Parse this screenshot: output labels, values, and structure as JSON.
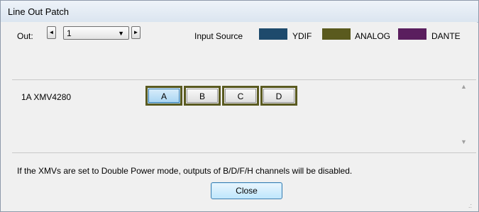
{
  "window": {
    "title": "Line Out Patch"
  },
  "out": {
    "label": "Out:",
    "prev_icon": "left-arrow-icon",
    "prev_glyph": "◄",
    "next_icon": "right-arrow-icon",
    "next_glyph": "►",
    "selected_value": "1",
    "dropdown_glyph": "▼"
  },
  "input_source": {
    "label": "Input Source",
    "legend": [
      {
        "label": "YDIF",
        "color": "#1e4a6c"
      },
      {
        "label": "ANALOG",
        "color": "#5a5a1e"
      },
      {
        "label": "DANTE",
        "color": "#5a1e5e"
      }
    ]
  },
  "device": {
    "name": "1A XMV4280",
    "channels": [
      {
        "label": "A",
        "selected": true
      },
      {
        "label": "B",
        "selected": false
      },
      {
        "label": "C",
        "selected": false
      },
      {
        "label": "D",
        "selected": false
      }
    ],
    "channel_border_color": "#5a5a20"
  },
  "scroll": {
    "up_glyph": "▲",
    "down_glyph": "▼"
  },
  "note": "If the XMVs are set to Double Power mode, outputs of  B/D/F/H channels will be disabled.",
  "buttons": {
    "close_label": "Close"
  },
  "grip_glyph": ".:"
}
